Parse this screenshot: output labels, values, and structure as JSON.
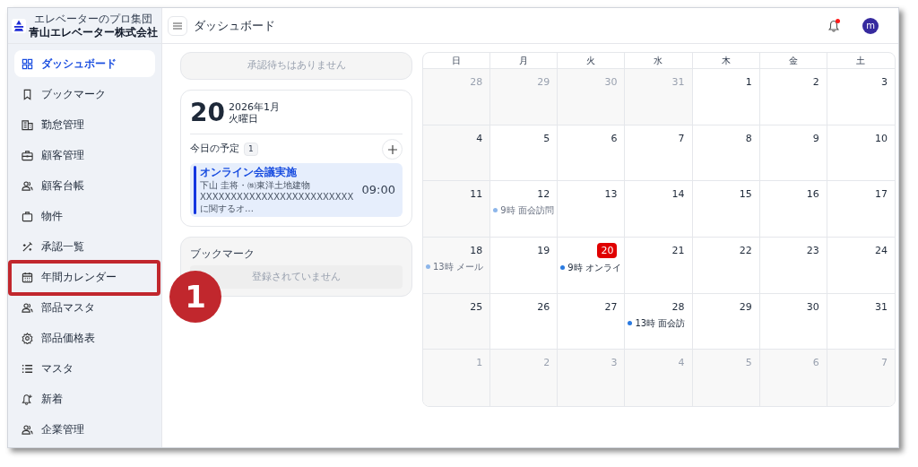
{
  "brand": {
    "tagline": "エレベーターのプロ集団",
    "name": "青山エレベーター株式会社"
  },
  "sidebar": {
    "items": [
      {
        "label": "ダッシュボード",
        "selected": true,
        "highlighted": false
      },
      {
        "label": "ブックマーク",
        "selected": false,
        "highlighted": false
      },
      {
        "label": "勤怠管理",
        "selected": false,
        "highlighted": false
      },
      {
        "label": "顧客管理",
        "selected": false,
        "highlighted": false
      },
      {
        "label": "顧客台帳",
        "selected": false,
        "highlighted": false
      },
      {
        "label": "物件",
        "selected": false,
        "highlighted": false
      },
      {
        "label": "承認一覧",
        "selected": false,
        "highlighted": false
      },
      {
        "label": "年間カレンダー",
        "selected": false,
        "highlighted": true
      },
      {
        "label": "部品マスタ",
        "selected": false,
        "highlighted": false
      },
      {
        "label": "部品価格表",
        "selected": false,
        "highlighted": false
      },
      {
        "label": "マスタ",
        "selected": false,
        "highlighted": false
      },
      {
        "label": "新着",
        "selected": false,
        "highlighted": false
      },
      {
        "label": "企業管理",
        "selected": false,
        "highlighted": false
      }
    ]
  },
  "callout": {
    "label": "1"
  },
  "header": {
    "title": "ダッシュボード",
    "notification_unread": true,
    "avatar": "m"
  },
  "approvals": {
    "message": "承認待ちはありません"
  },
  "today": {
    "day": "20",
    "month": "2026年1月",
    "weekday": "火曜日",
    "schedule_label": "今日の予定",
    "count": "1",
    "events": [
      {
        "title": "オンライン会議実施",
        "people": "下山 圭将・㈱東洋土地建物",
        "description": "XXXXXXXXXXXXXXXXXXXXXXXXXに関するオ…",
        "time": "09:00"
      }
    ]
  },
  "bookmarks": {
    "title": "ブックマーク",
    "message": "登録されていません"
  },
  "calendar": {
    "weekdays": [
      "日",
      "月",
      "火",
      "水",
      "木",
      "金",
      "土"
    ],
    "weeks": [
      [
        {
          "day": "28",
          "muted": true
        },
        {
          "day": "29",
          "muted": true
        },
        {
          "day": "30",
          "muted": true
        },
        {
          "day": "31",
          "muted": true
        },
        {
          "day": "1",
          "muted": false
        },
        {
          "day": "2",
          "muted": false
        },
        {
          "day": "3",
          "muted": false
        }
      ],
      [
        {
          "day": "4",
          "muted": false
        },
        {
          "day": "5",
          "muted": false
        },
        {
          "day": "6",
          "muted": false
        },
        {
          "day": "7",
          "muted": false
        },
        {
          "day": "8",
          "muted": false
        },
        {
          "day": "9",
          "muted": false
        },
        {
          "day": "10",
          "muted": false
        }
      ],
      [
        {
          "day": "11",
          "muted": false
        },
        {
          "day": "12",
          "muted": false,
          "events": [
            {
              "text": "9時 面会訪問",
              "past": true
            }
          ]
        },
        {
          "day": "13",
          "muted": false
        },
        {
          "day": "14",
          "muted": false
        },
        {
          "day": "15",
          "muted": false
        },
        {
          "day": "16",
          "muted": false
        },
        {
          "day": "17",
          "muted": false
        }
      ],
      [
        {
          "day": "18",
          "muted": false,
          "events": [
            {
              "text": "13時 メール",
              "past": true
            }
          ]
        },
        {
          "day": "19",
          "muted": false
        },
        {
          "day": "20",
          "muted": false,
          "today": true,
          "events": [
            {
              "text": "9時 オンライ",
              "past": false
            }
          ]
        },
        {
          "day": "21",
          "muted": false
        },
        {
          "day": "22",
          "muted": false
        },
        {
          "day": "23",
          "muted": false
        },
        {
          "day": "24",
          "muted": false
        }
      ],
      [
        {
          "day": "25",
          "muted": false
        },
        {
          "day": "26",
          "muted": false
        },
        {
          "day": "27",
          "muted": false
        },
        {
          "day": "28",
          "muted": false,
          "events": [
            {
              "text": "13時 面会訪",
              "past": false
            }
          ]
        },
        {
          "day": "29",
          "muted": false
        },
        {
          "day": "30",
          "muted": false
        },
        {
          "day": "31",
          "muted": false
        }
      ],
      [
        {
          "day": "1",
          "muted": true
        },
        {
          "day": "2",
          "muted": true
        },
        {
          "day": "3",
          "muted": true
        },
        {
          "day": "4",
          "muted": true
        },
        {
          "day": "5",
          "muted": true
        },
        {
          "day": "6",
          "muted": true
        },
        {
          "day": "7",
          "muted": true
        }
      ]
    ]
  }
}
